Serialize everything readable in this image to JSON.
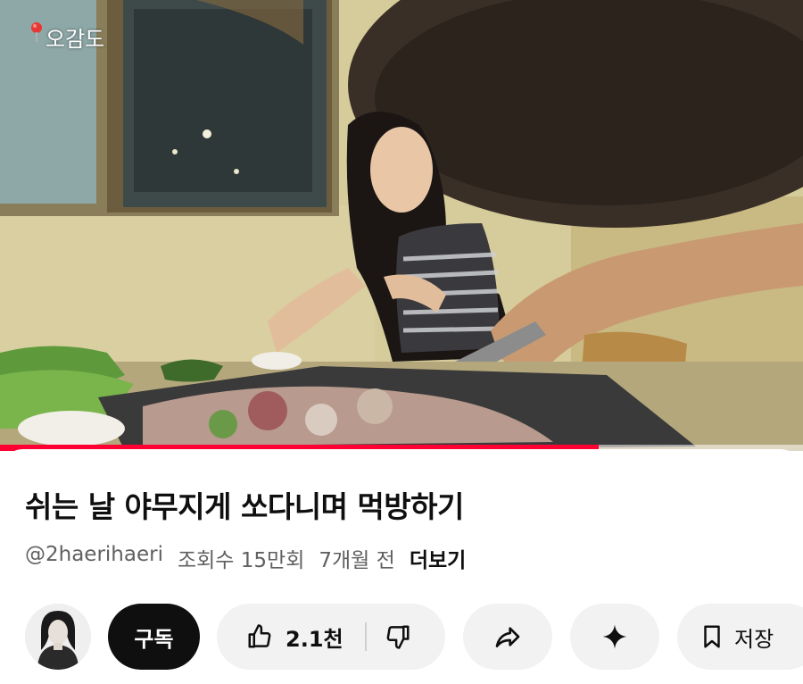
{
  "video": {
    "location_tag": "오감도",
    "progress_fraction": 0.745
  },
  "info": {
    "title": "쉬는 날 야무지게 쏘다니며 먹방하기",
    "channel_handle": "@2haerihaeri",
    "views": "조회수 15만회",
    "age": "7개월 전",
    "more_label": "더보기"
  },
  "actions": {
    "subscribe_label": "구독",
    "like_count": "2.1천",
    "save_label": "저장"
  },
  "icons": {
    "location": "map-pin-icon",
    "like": "thumbs-up-icon",
    "dislike": "thumbs-down-icon",
    "share": "share-arrow-icon",
    "ai": "sparkle-icon",
    "save": "bookmark-icon"
  },
  "colors": {
    "progress": "#ff0033",
    "subscribe_bg": "#0f0f0f",
    "pill_bg": "#f2f2f2"
  }
}
